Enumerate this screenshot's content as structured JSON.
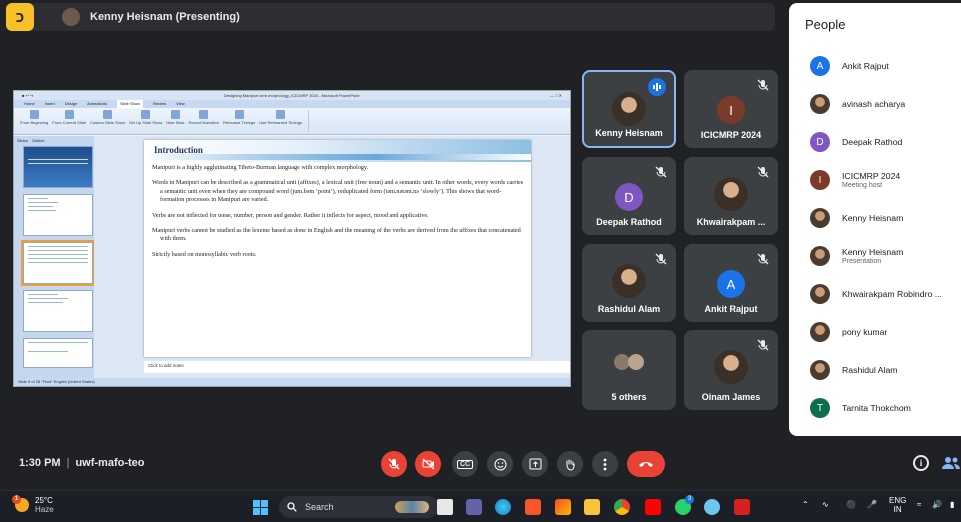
{
  "meeting": {
    "presenter_label": "Kenny Heisnam (Presenting)",
    "time": "1:30 PM",
    "code": "uwf-mafo-teo"
  },
  "slide_window": {
    "title_bar": "Designing Manipuri verb morphology_ICICMRP 2024 - Microsoft PowerPoint",
    "tabs": [
      "Home",
      "Insert",
      "Design",
      "Animations",
      "Slide Show",
      "Review",
      "View"
    ],
    "active_tab": "Slide Show",
    "ribbon": [
      "From Beginning",
      "From Current Slide",
      "Custom Slide Show",
      "Set Up Slide Show",
      "Hide Slide",
      "Record Narration",
      "Rehearse Timings",
      "Use Rehearsed Timings"
    ],
    "pane_tabs": [
      "Slides",
      "Outline"
    ],
    "notes_placeholder": "Click to add notes",
    "status": "Slide 9 of 28   \"Flow\"   English (United States)",
    "slide": {
      "title": "Introduction",
      "paragraphs": [
        "Manipuri is a highly agglutinating Tibeto-Burman language with complex morphology.",
        "Words in Manipuri can be described as a grammatical unit (affixes), a lexical unit (free noun) and a semantic unit. In other words, every words carries a semantic unit even when they are compound word (jum.bəm ‘point’), reduplicated form (təm.nətəm.nə ‘slowly’). This shows that word-formation processes in Manipuri are varied.",
        "Verbs are not inflected for tense, number, person and gender. Rather it inflects for aspect, mood and applicative.",
        "Manipuri verbs cannot be studied as the lexeme based as done in English and the meaning of the verbs are derived from the affixes that concatenated with them.",
        "Strictly based on monosyllabic verb roots."
      ]
    }
  },
  "tiles": [
    {
      "name": "Kenny Heisnam",
      "avatar": "photo",
      "speaking": true
    },
    {
      "name": "ICICMRP 2024",
      "initial": "I",
      "color": "#7b3b2b"
    },
    {
      "name": "Deepak Rathod",
      "initial": "D",
      "color": "#7e57c2"
    },
    {
      "name": "Khwairakpam ...",
      "avatar": "photo"
    },
    {
      "name": "Rashidul Alam",
      "avatar": "photo"
    },
    {
      "name": "Ankit Rajput",
      "initial": "A",
      "color": "#1a73e8"
    },
    {
      "name": "5 others",
      "avatar": "group"
    },
    {
      "name": "Oinam James",
      "avatar": "photo"
    }
  ],
  "people_panel": {
    "title": "People",
    "items": [
      {
        "name": "Ankit Rajput",
        "initial": "A",
        "color": "#1a73e8"
      },
      {
        "name": "avinash acharya",
        "avatar": "photo"
      },
      {
        "name": "Deepak Rathod",
        "initial": "D",
        "color": "#7e57c2"
      },
      {
        "name": "ICICMRP 2024",
        "sub": "Meeting host",
        "initial": "I",
        "color": "#7b3b2b"
      },
      {
        "name": "Kenny Heisnam",
        "avatar": "photo"
      },
      {
        "name": "Kenny Heisnam",
        "sub": "Presentation",
        "avatar": "photo"
      },
      {
        "name": "Khwairakpam Robindro ...",
        "avatar": "photo"
      },
      {
        "name": "pony kumar",
        "avatar": "photo"
      },
      {
        "name": "Rashidul Alam",
        "avatar": "photo"
      },
      {
        "name": "Tarnita Thokchom",
        "initial": "T",
        "color": "#0b6e4f"
      }
    ]
  },
  "controls": {
    "mic": "mic-off-icon",
    "camera": "camera-off-icon",
    "captions_label": "CC",
    "emoji": "emoji-icon",
    "present": "present-icon",
    "hand": "raise-hand-icon",
    "more": "more-vert-icon",
    "end": "end-call-icon"
  },
  "taskbar": {
    "temp": "25°C",
    "weather": "Haze",
    "weather_badge": "1",
    "search_label": "Search",
    "lang_top": "ENG",
    "lang_bottom": "IN",
    "whatsapp_badge": "3"
  },
  "colors": {
    "accent": "#8ab4f8",
    "danger": "#ea4335",
    "bg": "#202124",
    "tile": "#3c4043"
  }
}
